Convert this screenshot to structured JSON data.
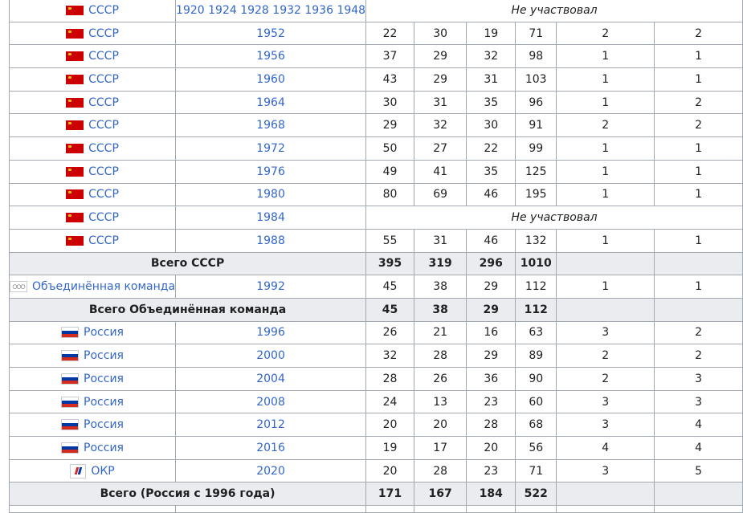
{
  "rows": [
    {
      "type": "header"
    },
    {
      "type": "absent",
      "team": "СССР",
      "flag": "ussr",
      "years": "1920 1924 1928 1932 1936 1948",
      "note": "Не участвовал"
    },
    {
      "type": "data",
      "team": "СССР",
      "flag": "ussr",
      "year": "1952",
      "v": [
        "22",
        "30",
        "19",
        "71",
        "2",
        "2"
      ]
    },
    {
      "type": "data",
      "team": "СССР",
      "flag": "ussr",
      "year": "1956",
      "v": [
        "37",
        "29",
        "32",
        "98",
        "1",
        "1"
      ]
    },
    {
      "type": "data",
      "team": "СССР",
      "flag": "ussr",
      "year": "1960",
      "v": [
        "43",
        "29",
        "31",
        "103",
        "1",
        "1"
      ]
    },
    {
      "type": "data",
      "team": "СССР",
      "flag": "ussr",
      "year": "1964",
      "v": [
        "30",
        "31",
        "35",
        "96",
        "1",
        "2"
      ]
    },
    {
      "type": "data",
      "team": "СССР",
      "flag": "ussr",
      "year": "1968",
      "v": [
        "29",
        "32",
        "30",
        "91",
        "2",
        "2"
      ]
    },
    {
      "type": "data",
      "team": "СССР",
      "flag": "ussr",
      "year": "1972",
      "v": [
        "50",
        "27",
        "22",
        "99",
        "1",
        "1"
      ]
    },
    {
      "type": "data",
      "team": "СССР",
      "flag": "ussr",
      "year": "1976",
      "v": [
        "49",
        "41",
        "35",
        "125",
        "1",
        "1"
      ]
    },
    {
      "type": "data",
      "team": "СССР",
      "flag": "ussr",
      "year": "1980",
      "v": [
        "80",
        "69",
        "46",
        "195",
        "1",
        "1"
      ]
    },
    {
      "type": "absent",
      "team": "СССР",
      "flag": "ussr",
      "years": "1984",
      "note": "Не участвовал"
    },
    {
      "type": "data",
      "team": "СССР",
      "flag": "ussr",
      "year": "1988",
      "v": [
        "55",
        "31",
        "46",
        "132",
        "1",
        "1"
      ]
    },
    {
      "type": "total",
      "label": "Всего СССР",
      "v": [
        "395",
        "319",
        "296",
        "1010"
      ]
    },
    {
      "type": "data",
      "team": "Объединённая команда",
      "flag": "olymp",
      "year": "1992",
      "v": [
        "45",
        "38",
        "29",
        "112",
        "1",
        "1"
      ]
    },
    {
      "type": "total",
      "label": "Всего Объединённая команда",
      "v": [
        "45",
        "38",
        "29",
        "112"
      ]
    },
    {
      "type": "data",
      "team": "Россия",
      "flag": "rus",
      "year": "1996",
      "v": [
        "26",
        "21",
        "16",
        "63",
        "3",
        "2"
      ]
    },
    {
      "type": "data",
      "team": "Россия",
      "flag": "rus",
      "year": "2000",
      "v": [
        "32",
        "28",
        "29",
        "89",
        "2",
        "2"
      ]
    },
    {
      "type": "data",
      "team": "Россия",
      "flag": "rus",
      "year": "2004",
      "v": [
        "28",
        "26",
        "36",
        "90",
        "2",
        "3"
      ]
    },
    {
      "type": "data",
      "team": "Россия",
      "flag": "rus",
      "year": "2008",
      "v": [
        "24",
        "13",
        "23",
        "60",
        "3",
        "3"
      ]
    },
    {
      "type": "data",
      "team": "Россия",
      "flag": "rus",
      "year": "2012",
      "v": [
        "20",
        "20",
        "28",
        "68",
        "3",
        "4"
      ]
    },
    {
      "type": "data",
      "team": "Россия",
      "flag": "rus",
      "year": "2016",
      "v": [
        "19",
        "17",
        "20",
        "56",
        "4",
        "4"
      ]
    },
    {
      "type": "data",
      "team": "ОКР",
      "flag": "okr",
      "year": "2020",
      "v": [
        "20",
        "28",
        "23",
        "71",
        "3",
        "5"
      ]
    },
    {
      "type": "total",
      "label": "Всего (Россия с 1996 года)",
      "v": [
        "171",
        "167",
        "184",
        "522"
      ]
    },
    {
      "type": "header"
    }
  ]
}
